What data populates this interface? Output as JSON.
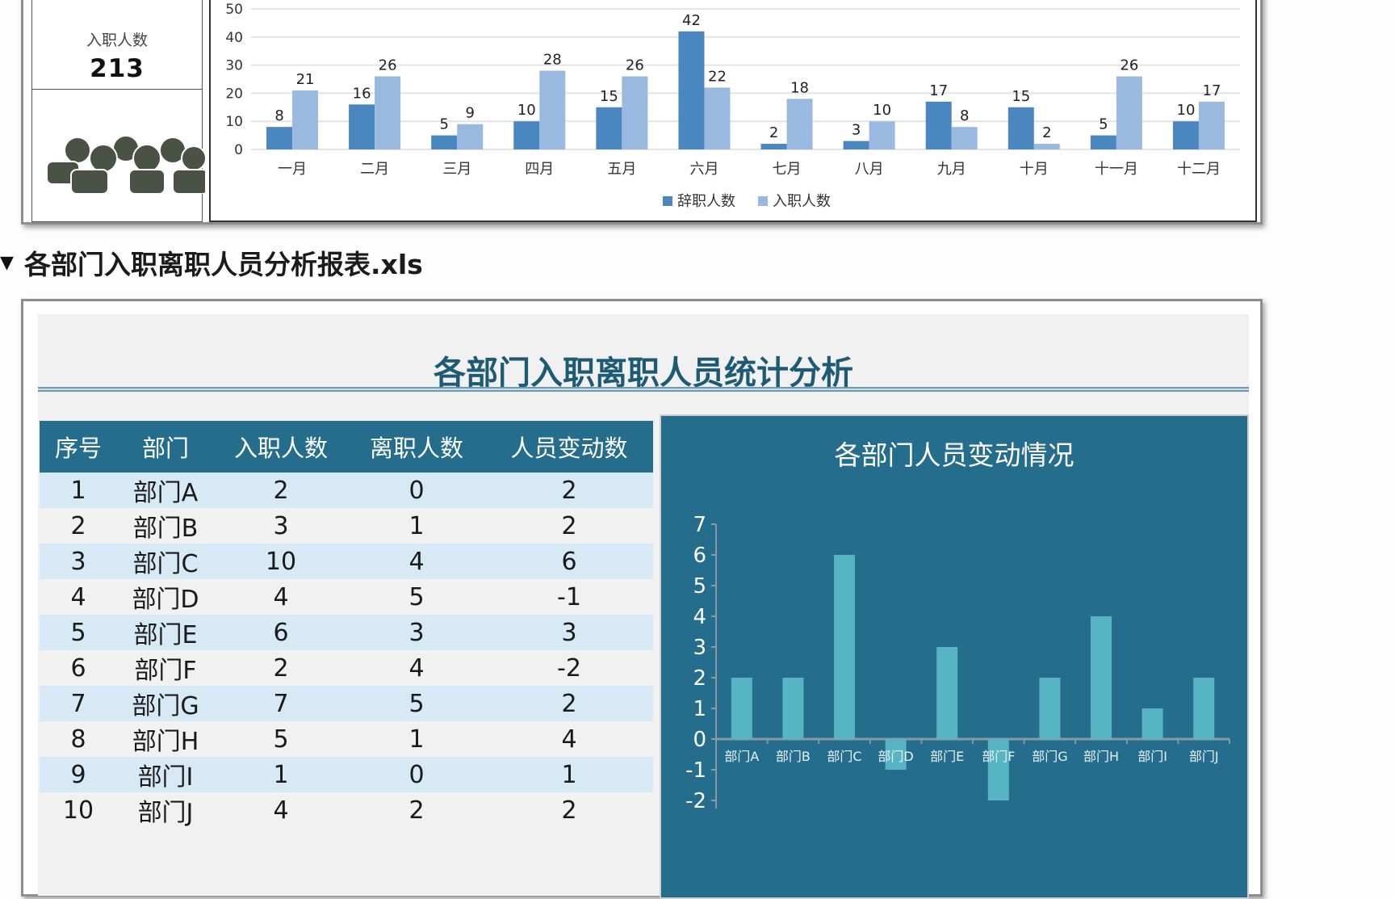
{
  "summary": {
    "label": "入职人数",
    "value": "213",
    "icon": "people-group-icon"
  },
  "section": {
    "toggle_icon": "▼",
    "title": "各部门入职离职人员分析报表.xls"
  },
  "sheet": {
    "title": "各部门入职离职人员统计分析",
    "table": {
      "headers": [
        "序号",
        "部门",
        "入职人数",
        "离职人数",
        "人员变动数"
      ],
      "rows": [
        [
          "1",
          "部门A",
          "2",
          "0",
          "2"
        ],
        [
          "2",
          "部门B",
          "3",
          "1",
          "2"
        ],
        [
          "3",
          "部门C",
          "10",
          "4",
          "6"
        ],
        [
          "4",
          "部门D",
          "4",
          "5",
          "-1"
        ],
        [
          "5",
          "部门E",
          "6",
          "3",
          "3"
        ],
        [
          "6",
          "部门F",
          "2",
          "4",
          "-2"
        ],
        [
          "7",
          "部门G",
          "7",
          "5",
          "2"
        ],
        [
          "8",
          "部门H",
          "5",
          "1",
          "4"
        ],
        [
          "9",
          "部门I",
          "1",
          "0",
          "1"
        ],
        [
          "10",
          "部门J",
          "4",
          "2",
          "2"
        ]
      ]
    }
  },
  "colors": {
    "resign": "#4a86c0",
    "hire": "#9ab9e1",
    "teal_bar": "#56b4c3",
    "panel": "#246d8c"
  },
  "chart_data": [
    {
      "type": "bar",
      "title": "",
      "categories": [
        "一月",
        "二月",
        "三月",
        "四月",
        "五月",
        "六月",
        "七月",
        "八月",
        "九月",
        "十月",
        "十一月",
        "十二月"
      ],
      "series": [
        {
          "name": "辞职人数",
          "values": [
            8,
            16,
            5,
            10,
            15,
            42,
            2,
            3,
            17,
            15,
            5,
            10
          ]
        },
        {
          "name": "入职人数",
          "values": [
            21,
            26,
            9,
            28,
            26,
            22,
            18,
            10,
            8,
            2,
            26,
            17
          ]
        }
      ],
      "yticks": [
        0,
        10,
        20,
        30,
        40,
        50
      ],
      "ylim": [
        0,
        50
      ],
      "xlabel": "",
      "ylabel": "",
      "grid": true,
      "legend": "bottom"
    },
    {
      "type": "bar",
      "title": "各部门人员变动情况",
      "categories": [
        "部门A",
        "部门B",
        "部门C",
        "部门D",
        "部门E",
        "部门F",
        "部门G",
        "部门H",
        "部门I",
        "部门J"
      ],
      "values": [
        2,
        2,
        6,
        -1,
        3,
        -2,
        2,
        4,
        1,
        2
      ],
      "yticks": [
        -2,
        -1,
        0,
        1,
        2,
        3,
        4,
        5,
        6,
        7
      ],
      "ylim": [
        -2,
        7
      ],
      "xlabel": "",
      "ylabel": "",
      "grid": false,
      "legend": "none"
    }
  ]
}
